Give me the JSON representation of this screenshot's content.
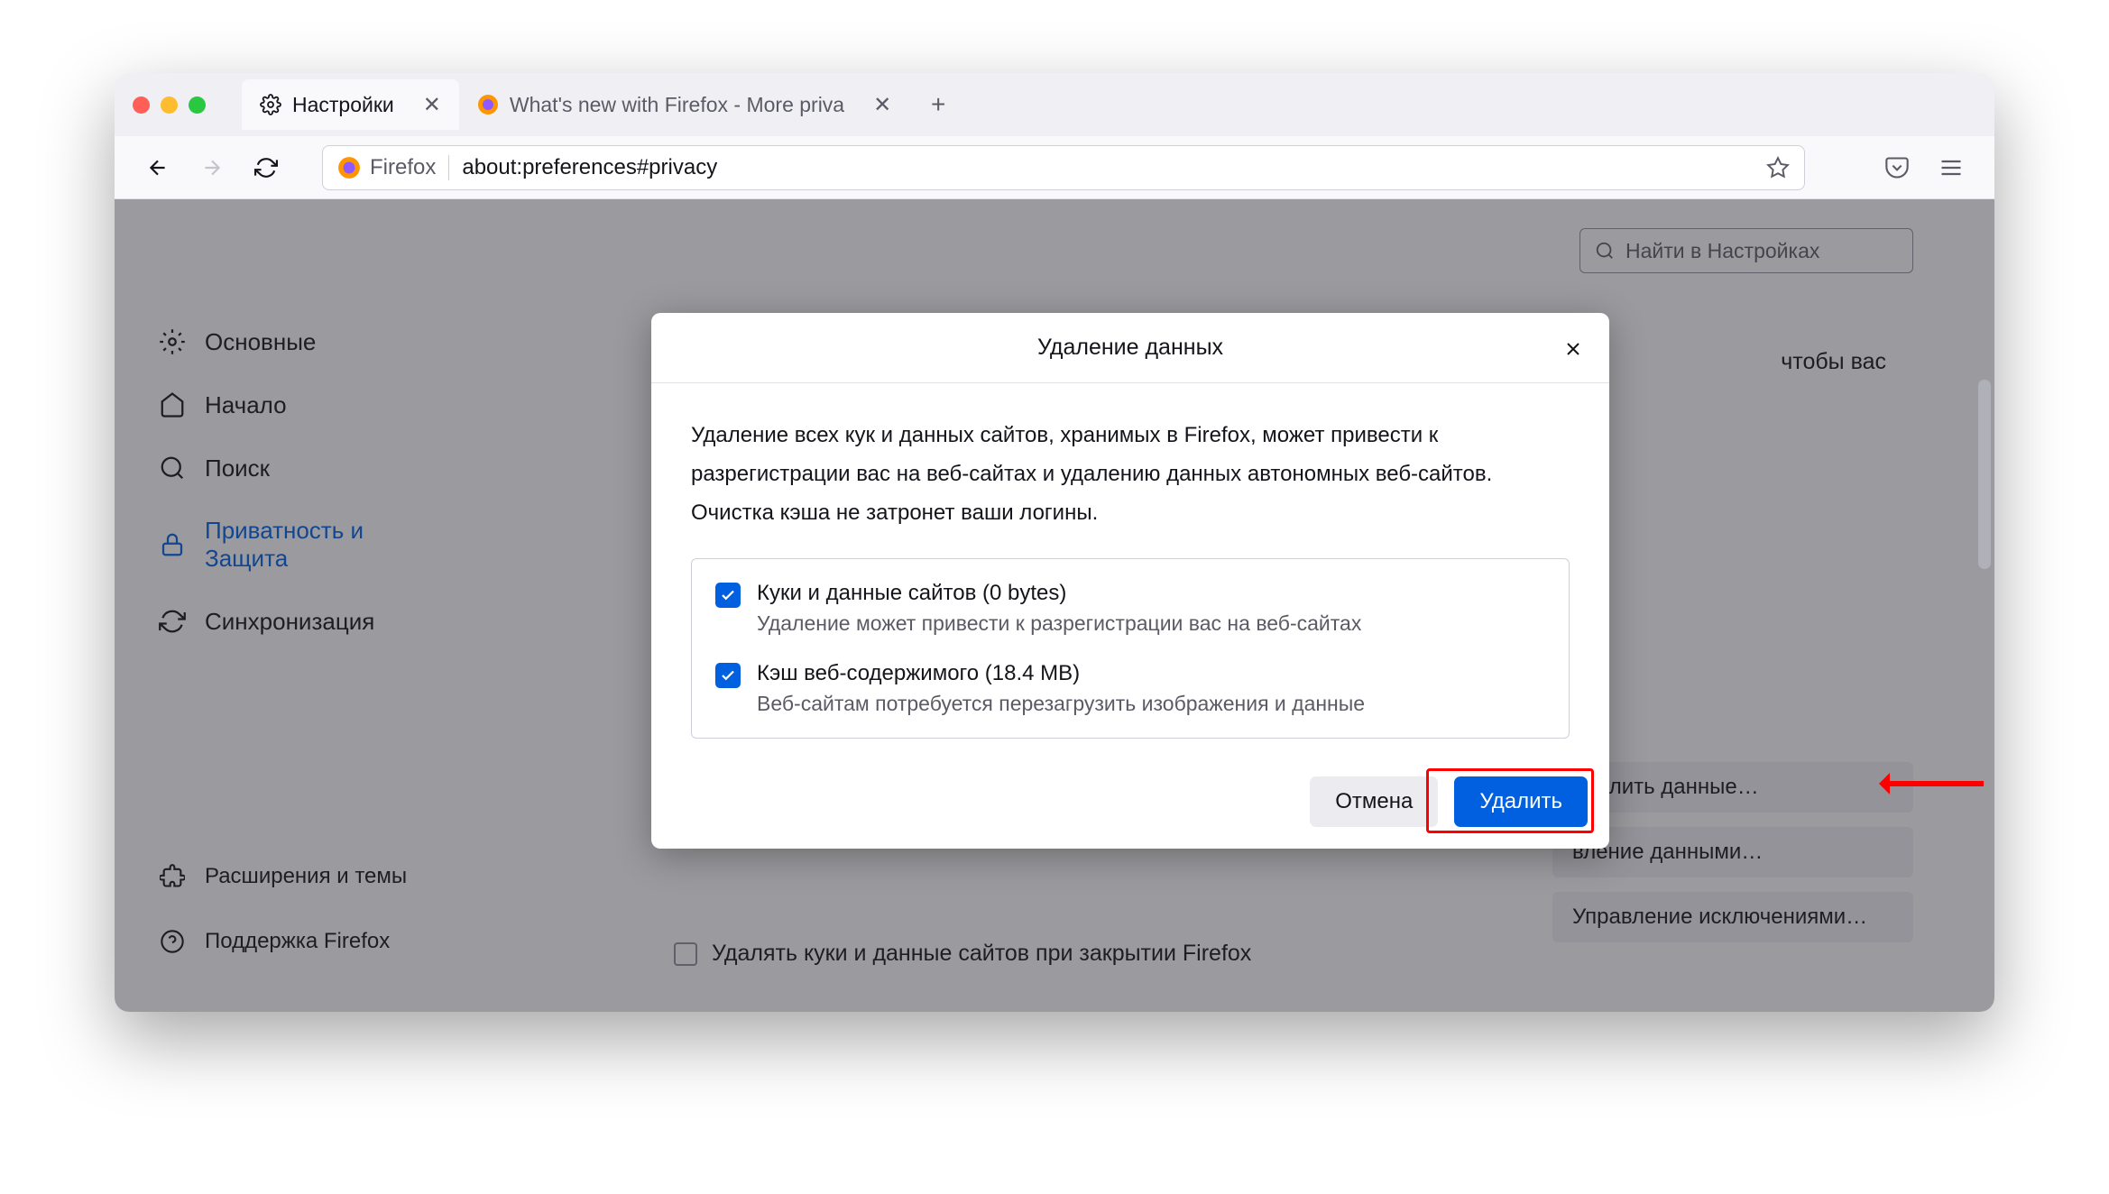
{
  "tabs": [
    {
      "label": "Настройки",
      "active": true
    },
    {
      "label": "What's new with Firefox - More priva",
      "active": false
    }
  ],
  "urlbar": {
    "identity": "Firefox",
    "address": "about:preferences#privacy"
  },
  "search_settings_placeholder": "Найти в Настройках",
  "sidebar": {
    "items": [
      {
        "label": "Основные"
      },
      {
        "label": "Начало"
      },
      {
        "label": "Поиск"
      },
      {
        "label": "Приватность и Защита"
      },
      {
        "label": "Синхронизация"
      }
    ],
    "bottom": [
      {
        "label": "Расширения и темы"
      },
      {
        "label": "Поддержка Firefox"
      }
    ]
  },
  "bg": {
    "text_fragment": "чтобы вас",
    "buttons": [
      "Удалить данные…",
      "вление данными…",
      "Управление исключениями…"
    ],
    "checkbox_label": "Удалять куки и данные сайтов при закрытии Firefox"
  },
  "dialog": {
    "title": "Удаление данных",
    "body_text": "Удаление всех кук и данных сайтов, хранимых в Firefox, может привести к разрегистрации вас на веб-сайтах и удалению данных автономных веб-сайтов. Очистка кэша не затронет ваши логины.",
    "items": [
      {
        "main": "Куки и данные сайтов (0 bytes)",
        "sub": "Удаление может привести к разрегистрации вас на веб-сайтах"
      },
      {
        "main": "Кэш веб-содержимого (18.4 MB)",
        "sub": "Веб-сайтам потребуется перезагрузить изображения и данные"
      }
    ],
    "cancel": "Отмена",
    "delete": "Удалить"
  }
}
